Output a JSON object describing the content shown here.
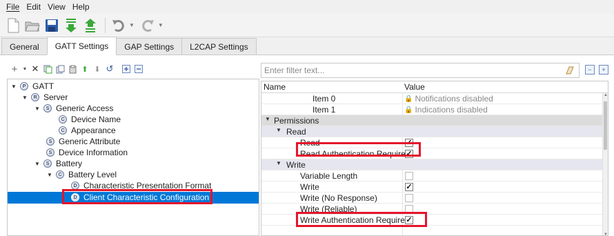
{
  "menu": {
    "file": "File",
    "edit": "Edit",
    "view": "View",
    "help": "Help"
  },
  "tabs": [
    {
      "label": "General"
    },
    {
      "label": "GATT Settings"
    },
    {
      "label": "GAP Settings"
    },
    {
      "label": "L2CAP Settings"
    }
  ],
  "active_tab": "GATT Settings",
  "tree": {
    "nodes": [
      {
        "badge": "P",
        "label": "GATT"
      },
      {
        "badge": "R",
        "label": "Server"
      },
      {
        "badge": "S",
        "label": "Generic Access"
      },
      {
        "badge": "C",
        "label": "Device Name"
      },
      {
        "badge": "C",
        "label": "Appearance"
      },
      {
        "badge": "S",
        "label": "Generic Attribute"
      },
      {
        "badge": "S",
        "label": "Device Information"
      },
      {
        "badge": "S",
        "label": "Battery"
      },
      {
        "badge": "C",
        "label": "Battery Level"
      },
      {
        "badge": "D",
        "label": "Characteristic Presentation Format"
      },
      {
        "badge": "D",
        "label": "Client Characteristic Configuration"
      }
    ],
    "selected": "Client Characteristic Configuration"
  },
  "filter": {
    "placeholder": "Enter filter text..."
  },
  "grid": {
    "col_name": "Name",
    "col_value": "Value",
    "rows": [
      {
        "name": "Item 0",
        "value": "Notifications disabled"
      },
      {
        "name": "Item 1",
        "value": "Indications disabled"
      },
      {
        "name": "Permissions"
      },
      {
        "name": "Read"
      },
      {
        "name": "Read",
        "checked": true
      },
      {
        "name": "Read Authentication Required",
        "checked": true
      },
      {
        "name": "Write"
      },
      {
        "name": "Variable Length",
        "checked": false
      },
      {
        "name": "Write",
        "checked": true
      },
      {
        "name": "Write (No Response)",
        "checked": false
      },
      {
        "name": "Write (Reliable)",
        "checked": false
      },
      {
        "name": "Write Authentication Required",
        "checked": true
      }
    ]
  },
  "check_glyph": "✓",
  "highlight_color": "#e5142b",
  "selection_color": "#0078d7"
}
